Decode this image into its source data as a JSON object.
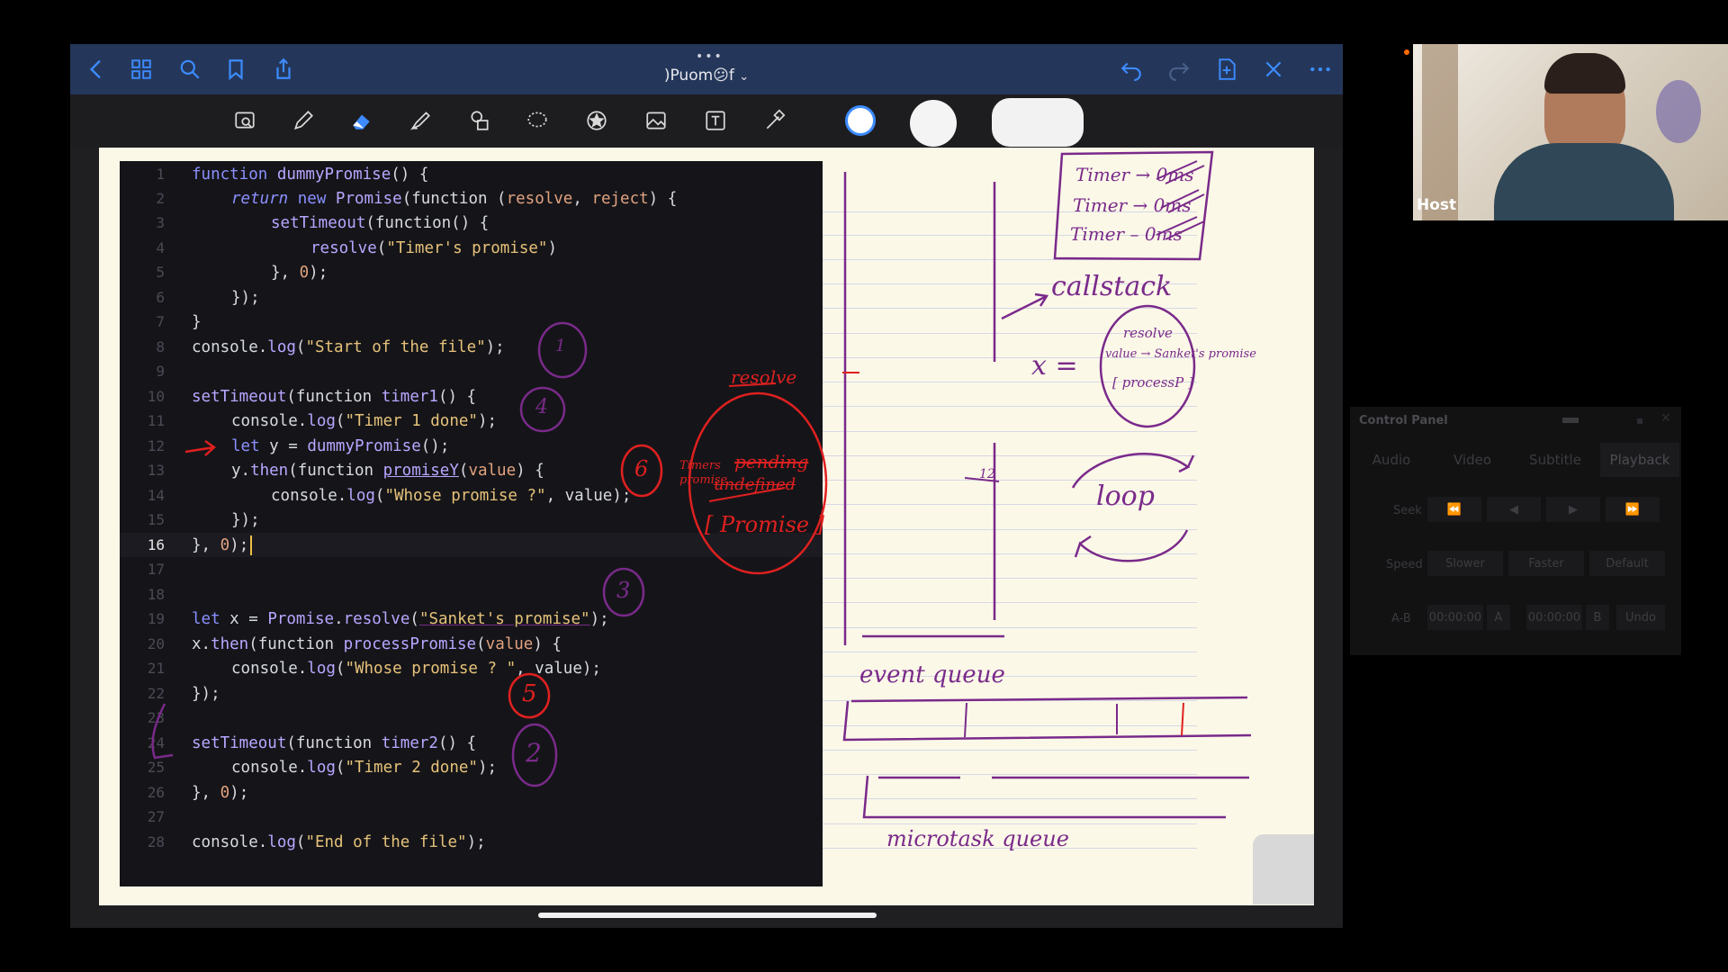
{
  "app": {
    "title": ")Puom😕f",
    "title_caret": "⌄",
    "top_dots": "•••"
  },
  "editor": {
    "lines": [
      {
        "n": "1"
      },
      {
        "n": "2"
      },
      {
        "n": "3"
      },
      {
        "n": "4"
      },
      {
        "n": "5"
      },
      {
        "n": "6"
      },
      {
        "n": "7"
      },
      {
        "n": "8"
      },
      {
        "n": "9"
      },
      {
        "n": "10"
      },
      {
        "n": "11"
      },
      {
        "n": "12"
      },
      {
        "n": "13"
      },
      {
        "n": "14"
      },
      {
        "n": "15"
      },
      {
        "n": "16"
      },
      {
        "n": "17"
      },
      {
        "n": "18"
      },
      {
        "n": "19"
      },
      {
        "n": "20"
      },
      {
        "n": "21"
      },
      {
        "n": "22"
      },
      {
        "n": "23"
      },
      {
        "n": "24"
      },
      {
        "n": "25"
      },
      {
        "n": "26"
      },
      {
        "n": "27"
      },
      {
        "n": "28"
      }
    ],
    "code": {
      "l1a": "function ",
      "l1b": "dummyPromise",
      "l1c": "() {",
      "l2a": "return ",
      "l2b": "new ",
      "l2c": "Promise",
      "l2d": "(function (",
      "l2e": "resolve",
      "l2f": ", ",
      "l2g": "reject",
      "l2h": ") {",
      "l3a": "setTimeout",
      "l3b": "(function() {",
      "l4a": "resolve",
      "l4b": "(",
      "l4c": "\"Timer's promise\"",
      "l4d": ")",
      "l5a": "}, ",
      "l5b": "0",
      "l5c": ");",
      "l6": "});",
      "l7": "}",
      "l8a": "console.",
      "l8b": "log",
      "l8c": "(",
      "l8d": "\"Start of the file\"",
      "l8e": ");",
      "l10a": "setTimeout",
      "l10b": "(function ",
      "l10c": "timer1",
      "l10d": "() {",
      "l11a": "console.",
      "l11b": "log",
      "l11c": "(",
      "l11d": "\"Timer 1 done\"",
      "l11e": ");",
      "l12a": "let ",
      "l12b": "y = ",
      "l12c": "dummyPromise",
      "l12d": "();",
      "l13a": "y.",
      "l13b": "then",
      "l13c": "(function ",
      "l13d": "promiseY",
      "l13e": "(",
      "l13f": "value",
      "l13g": ") {",
      "l14a": "console.",
      "l14b": "log",
      "l14c": "(",
      "l14d": "\"Whose promise ?\"",
      "l14e": ", value);",
      "l15": "});",
      "l16a": "}, ",
      "l16b": "0",
      "l16c": ");",
      "l19a": "let ",
      "l19b": "x = ",
      "l19c": "Promise",
      "l19d": ".",
      "l19e": "resolve",
      "l19f": "(",
      "l19g": "\"Sanket's promise\"",
      "l19h": ");",
      "l20a": "x.",
      "l20b": "then",
      "l20c": "(function ",
      "l20d": "processPromise",
      "l20e": "(",
      "l20f": "value",
      "l20g": ") {",
      "l21a": "console.",
      "l21b": "log",
      "l21c": "(",
      "l21d": "\"Whose promise ? \"",
      "l21e": ", value);",
      "l22": "});",
      "l24a": "setTimeout",
      "l24b": "(function ",
      "l24c": "timer2",
      "l24d": "() {",
      "l25a": "console.",
      "l25b": "log",
      "l25c": "(",
      "l25d": "\"Timer 2 done\"",
      "l25e": ");",
      "l26a": "}, ",
      "l26b": "0",
      "l26c": ");",
      "l28a": "console.",
      "l28b": "log",
      "l28c": "(",
      "l28d": "\"End of the file\"",
      "l28e": ");"
    }
  },
  "annotations": {
    "n1": "1",
    "n4": "4",
    "n6": "6",
    "n3": "3",
    "n5": "5",
    "n2": "2",
    "timers_promise": "Timers promise",
    "resolve": "resolve",
    "pending": "pending",
    "undefined": "undefined",
    "promise_box": "[ Promise ]",
    "callstack": "callstack",
    "timer1": "Timer → 0ms",
    "timer2": "Timer → 0ms",
    "timer3": "Timer – 0ms",
    "x_eq": "x =",
    "x_resolve": "resolve",
    "x_value": "value → Sanket's promise",
    "x_promise": "[ processP ]",
    "loop": "loop",
    "event_queue": "event queue",
    "microtask": "microtask queue",
    "marker_12": "12"
  },
  "webcam": {
    "label": "Host"
  },
  "control_panel": {
    "title": "Control Panel",
    "tabs": [
      "Audio",
      "Video",
      "Subtitle",
      "Playback"
    ],
    "seek_label": "Seek",
    "speed_label": "Speed",
    "speed_buttons": [
      "Slower",
      "Faster",
      "Default"
    ],
    "ab_label": "A-B",
    "a_time": "00:00:00",
    "a_btn": "A",
    "b_time": "00:00:00",
    "b_btn": "B",
    "undo": "Undo"
  },
  "colors": {
    "top_bar": "#24375a",
    "page": "#fbf8e8",
    "editor_bg": "#151519",
    "purple_ink": "#7a2a8a",
    "red_ink": "#e02020"
  }
}
